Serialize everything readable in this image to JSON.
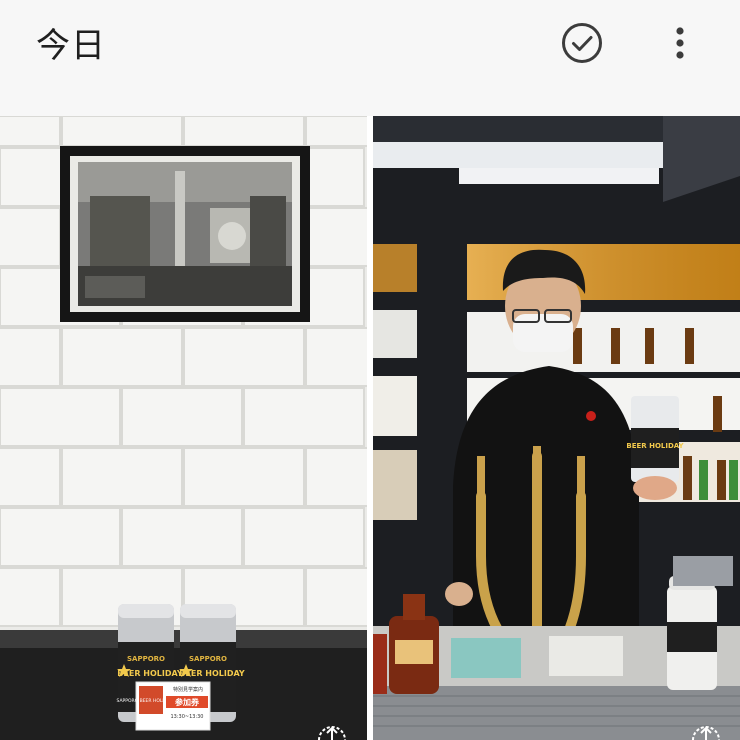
{
  "header": {
    "title": "今日",
    "select_icon": "check-circle-icon",
    "more_icon": "more-vert-icon"
  },
  "photos": [
    {
      "id_label": "photo-1",
      "cup_brand": "SAPPORO",
      "cup_text": "BEER HOLIDAY",
      "card_top": "SAPPORO BEER HOLIDAY 2024",
      "card_stamp": "参加券",
      "card_note": "特別見学案内",
      "card_time": "13:30~13:30",
      "badge_icon": "cloud-upload-icon"
    },
    {
      "id_label": "photo-2",
      "cup_brand": "SAPPORO",
      "cup_text": "BEER HOLIDAY",
      "badge_icon": "cloud-upload-icon"
    }
  ],
  "colors": {
    "header_bg": "#f7f7f7",
    "icon": "#3c3c3c",
    "tile_wall": "#eeeeec",
    "bar_dark": "#1c1e22",
    "brass": "#c9a24a"
  }
}
